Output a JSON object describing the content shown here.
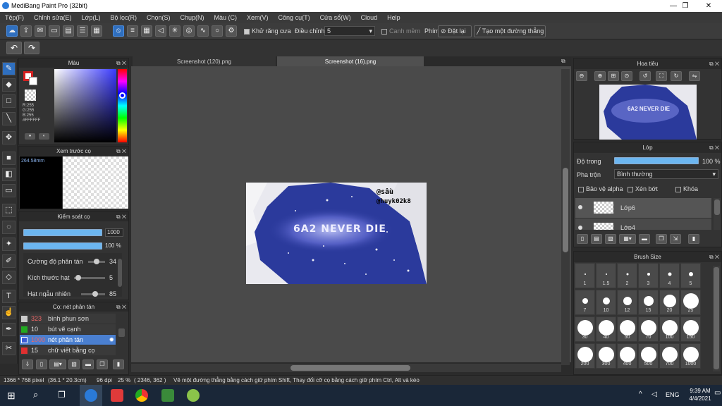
{
  "window": {
    "title": "MediBang Paint Pro (32bit)",
    "minimize": "—",
    "restore": "❐",
    "close": "✕"
  },
  "menu": [
    "Tệp(F)",
    "Chỉnh sửa(E)",
    "Lớp(L)",
    "Bộ lọc(R)",
    "Chọn(S)",
    "Chụp(N)",
    "Màu (C)",
    "Xem(V)",
    "Công cụ(T)",
    "Cửa sổ(W)",
    "Cloud",
    "Help"
  ],
  "toolbar": {
    "antialias_label": "Khử răng cưa",
    "adjust_label": "Điều chỉnh",
    "adjust_value": "5",
    "soft_edge_label": "Canh mềm",
    "key_label": "Phím",
    "reset_label": "Đặt lại",
    "make_line_label": "Tạo một đường thẳng"
  },
  "color_panel": {
    "title": "Màu",
    "r": "R:255",
    "g": "G:255",
    "b": "B:255",
    "hex": "#FFFFFF"
  },
  "preview_panel": {
    "title": "Xem trước cọ",
    "size": "264.58mm"
  },
  "control_panel": {
    "title": "Kiểm soát cọ",
    "size_value": "1000",
    "opacity_value": "100 %",
    "rows": [
      {
        "label": "Cường độ phân tán",
        "value": "34"
      },
      {
        "label": "Kích thước hạt",
        "value": "5"
      },
      {
        "label": "Hạt ngẫu nhiên",
        "value": "85"
      }
    ]
  },
  "brush_panel": {
    "title": "Cọ: nét phân tán",
    "items": [
      {
        "num": "323",
        "name": "bình phun sơn",
        "color": "#cccccc"
      },
      {
        "num": "10",
        "name": "bút vẽ cạnh",
        "color": "#22aa22"
      },
      {
        "num": "1000",
        "name": "nét phân tán",
        "color": "#3b5bd6"
      },
      {
        "num": "15",
        "name": "chữ viết bằng cọ",
        "color": "#e03030"
      }
    ]
  },
  "tabs": [
    "Screenshot (120).png",
    "Screenshot (16).png"
  ],
  "artwork": {
    "watermark_top": "@sầu",
    "watermark_bottom": "@huyk02k8",
    "headline": "6A2 NEVER DIE"
  },
  "navigator": {
    "title": "Hoa tiêu",
    "headline": "6A2 NEVER DIE"
  },
  "layer_panel": {
    "title": "Lớp",
    "opacity_label": "Độ trong",
    "opacity_value": "100 %",
    "blend_label": "Pha trộn",
    "blend_value": "Bình thường",
    "protect_alpha": "Bảo vệ alpha",
    "clipping": "Xén bớt",
    "lock": "Khóa",
    "layers": [
      "Lớp6",
      "Lớp4"
    ]
  },
  "brush_size_panel": {
    "title": "Brush Size",
    "sizes": [
      "1",
      "1.5",
      "2",
      "3",
      "4",
      "5",
      "7",
      "10",
      "12",
      "15",
      "20",
      "25",
      "30",
      "40",
      "50",
      "70",
      "100",
      "150",
      "200",
      "300",
      "400",
      "500",
      "700",
      "1000"
    ]
  },
  "status": {
    "dimensions": "1366 * 768 pixel",
    "physical": "(36.1 * 20.3cm)",
    "dpi": "96 dpi",
    "zoom": "25 %",
    "coords": "( 2346, 362 )",
    "hint": "Vẽ một đường thẳng bằng cách giữ phím Shift, Thay đổi cỡ cọ bằng cách giữ phím Ctrl, Alt và kéo"
  },
  "taskbar": {
    "lang": "ENG",
    "time": "9:39 AM",
    "date": "4/4/2021",
    "tray_up": "^"
  },
  "colors": {
    "accent": "#2f6fbf",
    "slider": "#6cb6f0",
    "art_blue": "#2b3a9c"
  }
}
